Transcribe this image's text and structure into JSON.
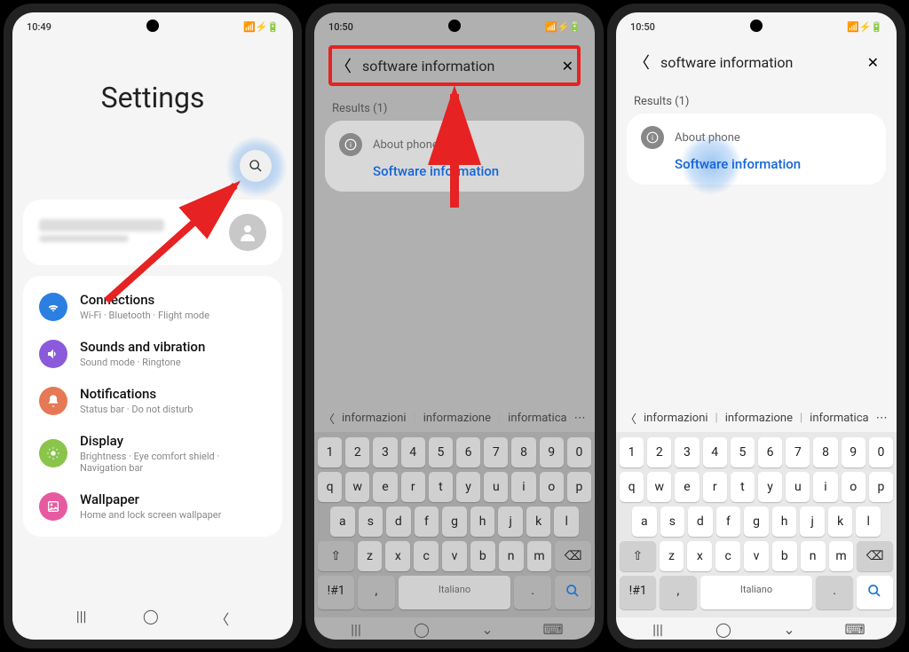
{
  "status": {
    "time1": "10:49",
    "time2": "10:50",
    "time3": "10:50",
    "icons_left": "⌂※✕◯",
    "icons_right": "📶⚡🔋"
  },
  "screen1": {
    "title": "Settings",
    "items": [
      {
        "title": "Connections",
        "sub": "Wi-Fi · Bluetooth · Flight mode",
        "color": "#2b7fe0"
      },
      {
        "title": "Sounds and vibration",
        "sub": "Sound mode · Ringtone",
        "color": "#8a5adb"
      },
      {
        "title": "Notifications",
        "sub": "Status bar · Do not disturb",
        "color": "#e77855"
      },
      {
        "title": "Display",
        "sub": "Brightness · Eye comfort shield · Navigation bar",
        "color": "#8ac44b"
      },
      {
        "title": "Wallpaper",
        "sub": "Home and lock screen wallpaper",
        "color": "#e85aa0"
      }
    ]
  },
  "screen2": {
    "query": "software information",
    "results_label": "Results (1)",
    "result_category": "About phone",
    "result_link": "Software information"
  },
  "screen3": {
    "query": "software information",
    "results_label": "Results (1)",
    "result_category": "About phone",
    "result_link": "Software information"
  },
  "suggest": {
    "w1": "informazioni",
    "w2": "informazione",
    "w3": "informatica"
  },
  "keyboard": {
    "row_num": [
      "1",
      "2",
      "3",
      "4",
      "5",
      "6",
      "7",
      "8",
      "9",
      "0"
    ],
    "row1": [
      "q",
      "w",
      "e",
      "r",
      "t",
      "y",
      "u",
      "i",
      "o",
      "p"
    ],
    "row2": [
      "a",
      "s",
      "d",
      "f",
      "g",
      "h",
      "j",
      "k",
      "l"
    ],
    "row3": [
      "z",
      "x",
      "c",
      "v",
      "b",
      "n",
      "m"
    ],
    "shift": "⇧",
    "bksp": "⌫",
    "sym": "!#1",
    "comma": ",",
    "space": "Italiano",
    "period": "."
  },
  "nav": {
    "recent": "|||",
    "home": "◯",
    "back": "〈"
  }
}
